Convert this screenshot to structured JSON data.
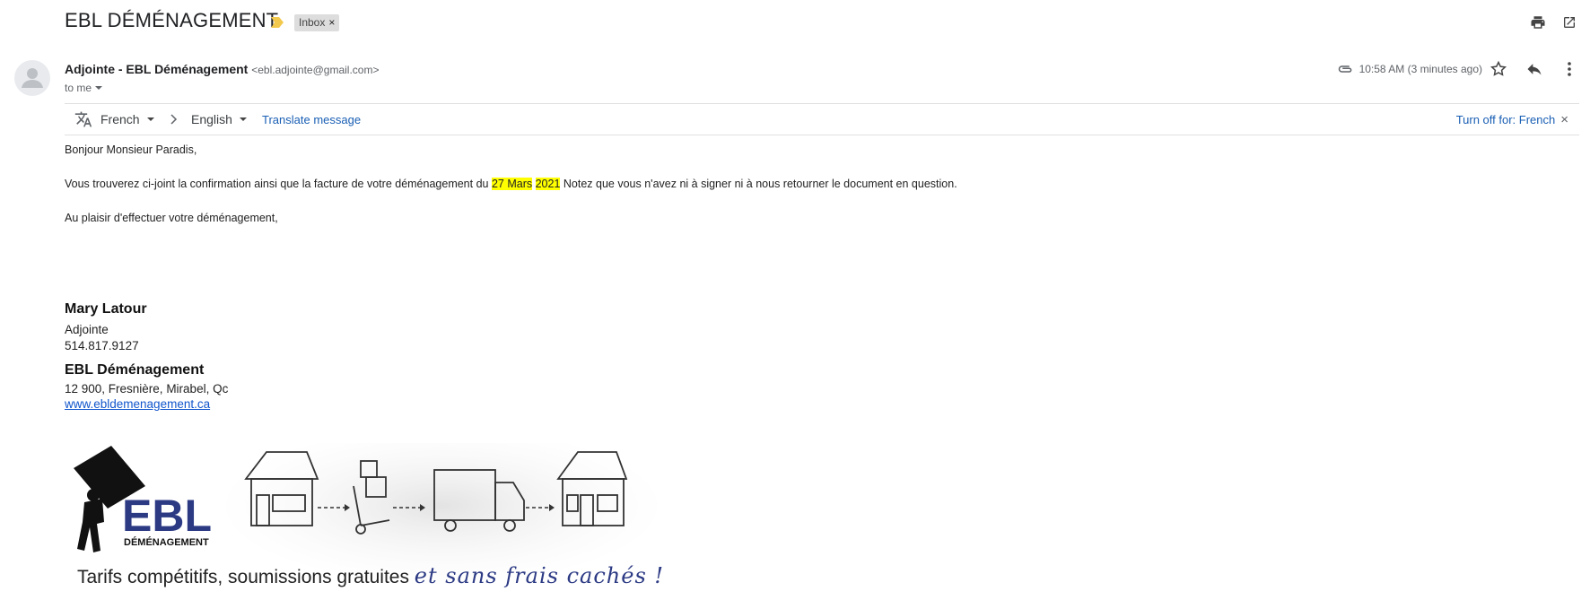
{
  "header": {
    "subject": "EBL DÉMÉNAGEMENT",
    "label": "Inbox",
    "label_remove": "×"
  },
  "sender": {
    "name": "Adjointe - EBL Déménagement",
    "email": "<ebl.adjointe@gmail.com>",
    "recipient": "to me",
    "time": "10:58 AM (3 minutes ago)"
  },
  "translate": {
    "source_lang": "French",
    "target_lang": "English",
    "translate_link": "Translate message",
    "turn_off": "Turn off for: French",
    "close": "×"
  },
  "message": {
    "greeting": "Bonjour Monsieur Paradis,",
    "line1_before": "Vous trouverez ci-joint la confirmation ainsi que la facture de votre déménagement du ",
    "line1_date_day": "27 Mars",
    "line1_date_year": "2021",
    "line1_after": " Notez que vous n'avez ni à signer ni à nous retourner le document en question.",
    "closing": "Au plaisir d'effectuer votre déménagement,"
  },
  "signature": {
    "name": "Mary Latour",
    "title": "Adjointe",
    "phone": "514.817.9127",
    "company": "EBL Déménagement",
    "address": "12 900, Fresnière, Mirabel, Qc",
    "website": "www.ebldemenagement.ca"
  },
  "banner": {
    "logo_main": "EBL",
    "logo_sub": "DÉMÉNAGEMENT",
    "tagline_plain": "Tarifs compétitifs, soumissions gratuites ",
    "tagline_script": "et sans frais cachés !"
  },
  "colors": {
    "highlight": "#ffff00",
    "link": "#1a5fb4",
    "brand_blue": "#2c3a84",
    "important_marker": "#f2c94c"
  }
}
